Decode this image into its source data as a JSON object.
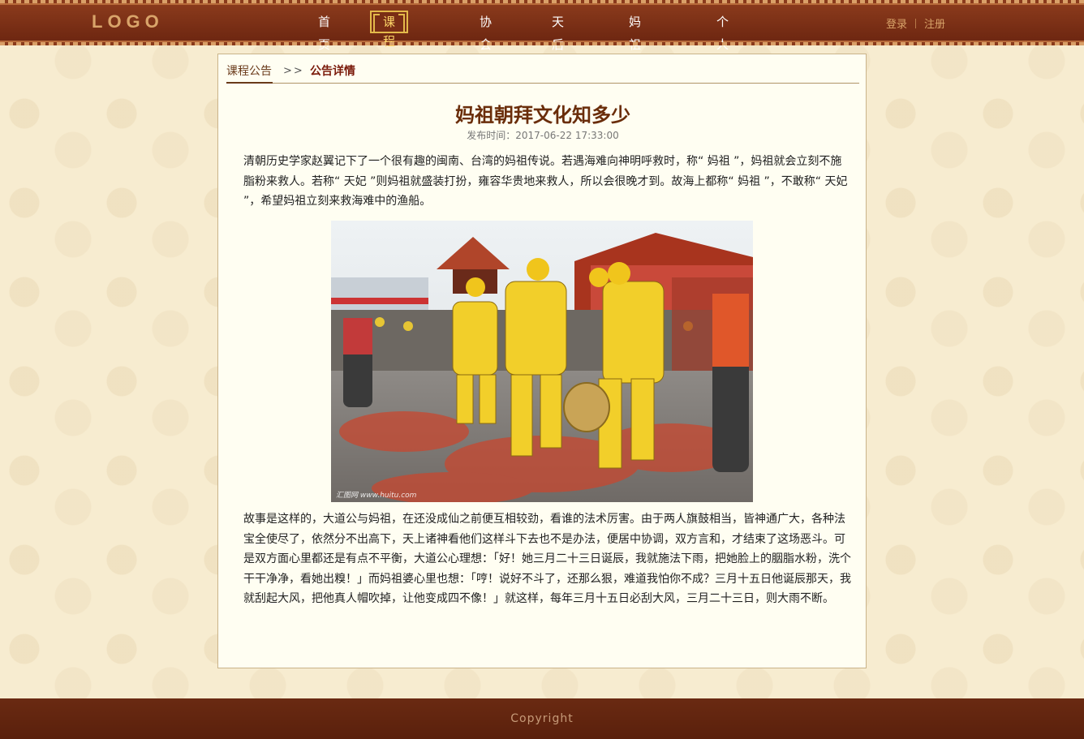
{
  "header": {
    "logo": "LOGO",
    "nav": [
      {
        "label": "首页"
      },
      {
        "label": "课程学院"
      },
      {
        "label": "协会"
      },
      {
        "label": "天后宫"
      },
      {
        "label": "妈祖世界"
      },
      {
        "label": "个人中心"
      }
    ],
    "active_nav": "课程学院",
    "login": "登录",
    "register": "注册"
  },
  "breadcrumb": {
    "parent": "课程公告",
    "separator": ">>",
    "current": "公告详情"
  },
  "article": {
    "title": "妈祖朝拜文化知多少",
    "publish_time": "发布时间：2017-06-22 17:33:00",
    "paragraph1": "清朝历史学家赵翼记下了一个很有趣的闽南、台湾的妈祖传说。若遇海难向神明呼救时，称“ 妈祖 ”，妈祖就会立刻不施脂粉来救人。若称“ 天妃 ”则妈祖就盛装打扮，雍容华贵地来救人，所以会很晚才到。故海上都称“ 妈祖 ”，不敢称“ 天妃 ”，希望妈祖立刻来救海难中的渔船。",
    "image_watermark": "汇图网 www.huitu.com",
    "paragraph2": "故事是这样的，大道公与妈祖，在还没成仙之前便互相较劲，看谁的法术厉害。由于两人旗鼓相当，皆神通广大，各种法宝全使尽了，依然分不出高下，天上诸神看他们这样斗下去也不是办法，便居中协调，双方言和，才结束了这场恶斗。可是双方面心里都还是有点不平衡，大道公心理想：「好！她三月二十三日诞辰，我就施法下雨，把她脸上的胭脂水粉，洗个干干净净，看她出糗！」而妈祖婆心里也想：「哼！说好不斗了，还那么狠，难道我怕你不成？三月十五日他诞辰那天，我就刮起大风，把他真人帽吹掉，让他变成四不像！」就这样，每年三月十五日必刮大风，三月二十三日，则大雨不断。"
  },
  "footer": {
    "copyright": "Copyright"
  },
  "colors": {
    "header_bg": "#7a2e15",
    "accent_gold": "#e3b94a",
    "title": "#6a2d0a",
    "page_bg": "#f7ecd0"
  }
}
